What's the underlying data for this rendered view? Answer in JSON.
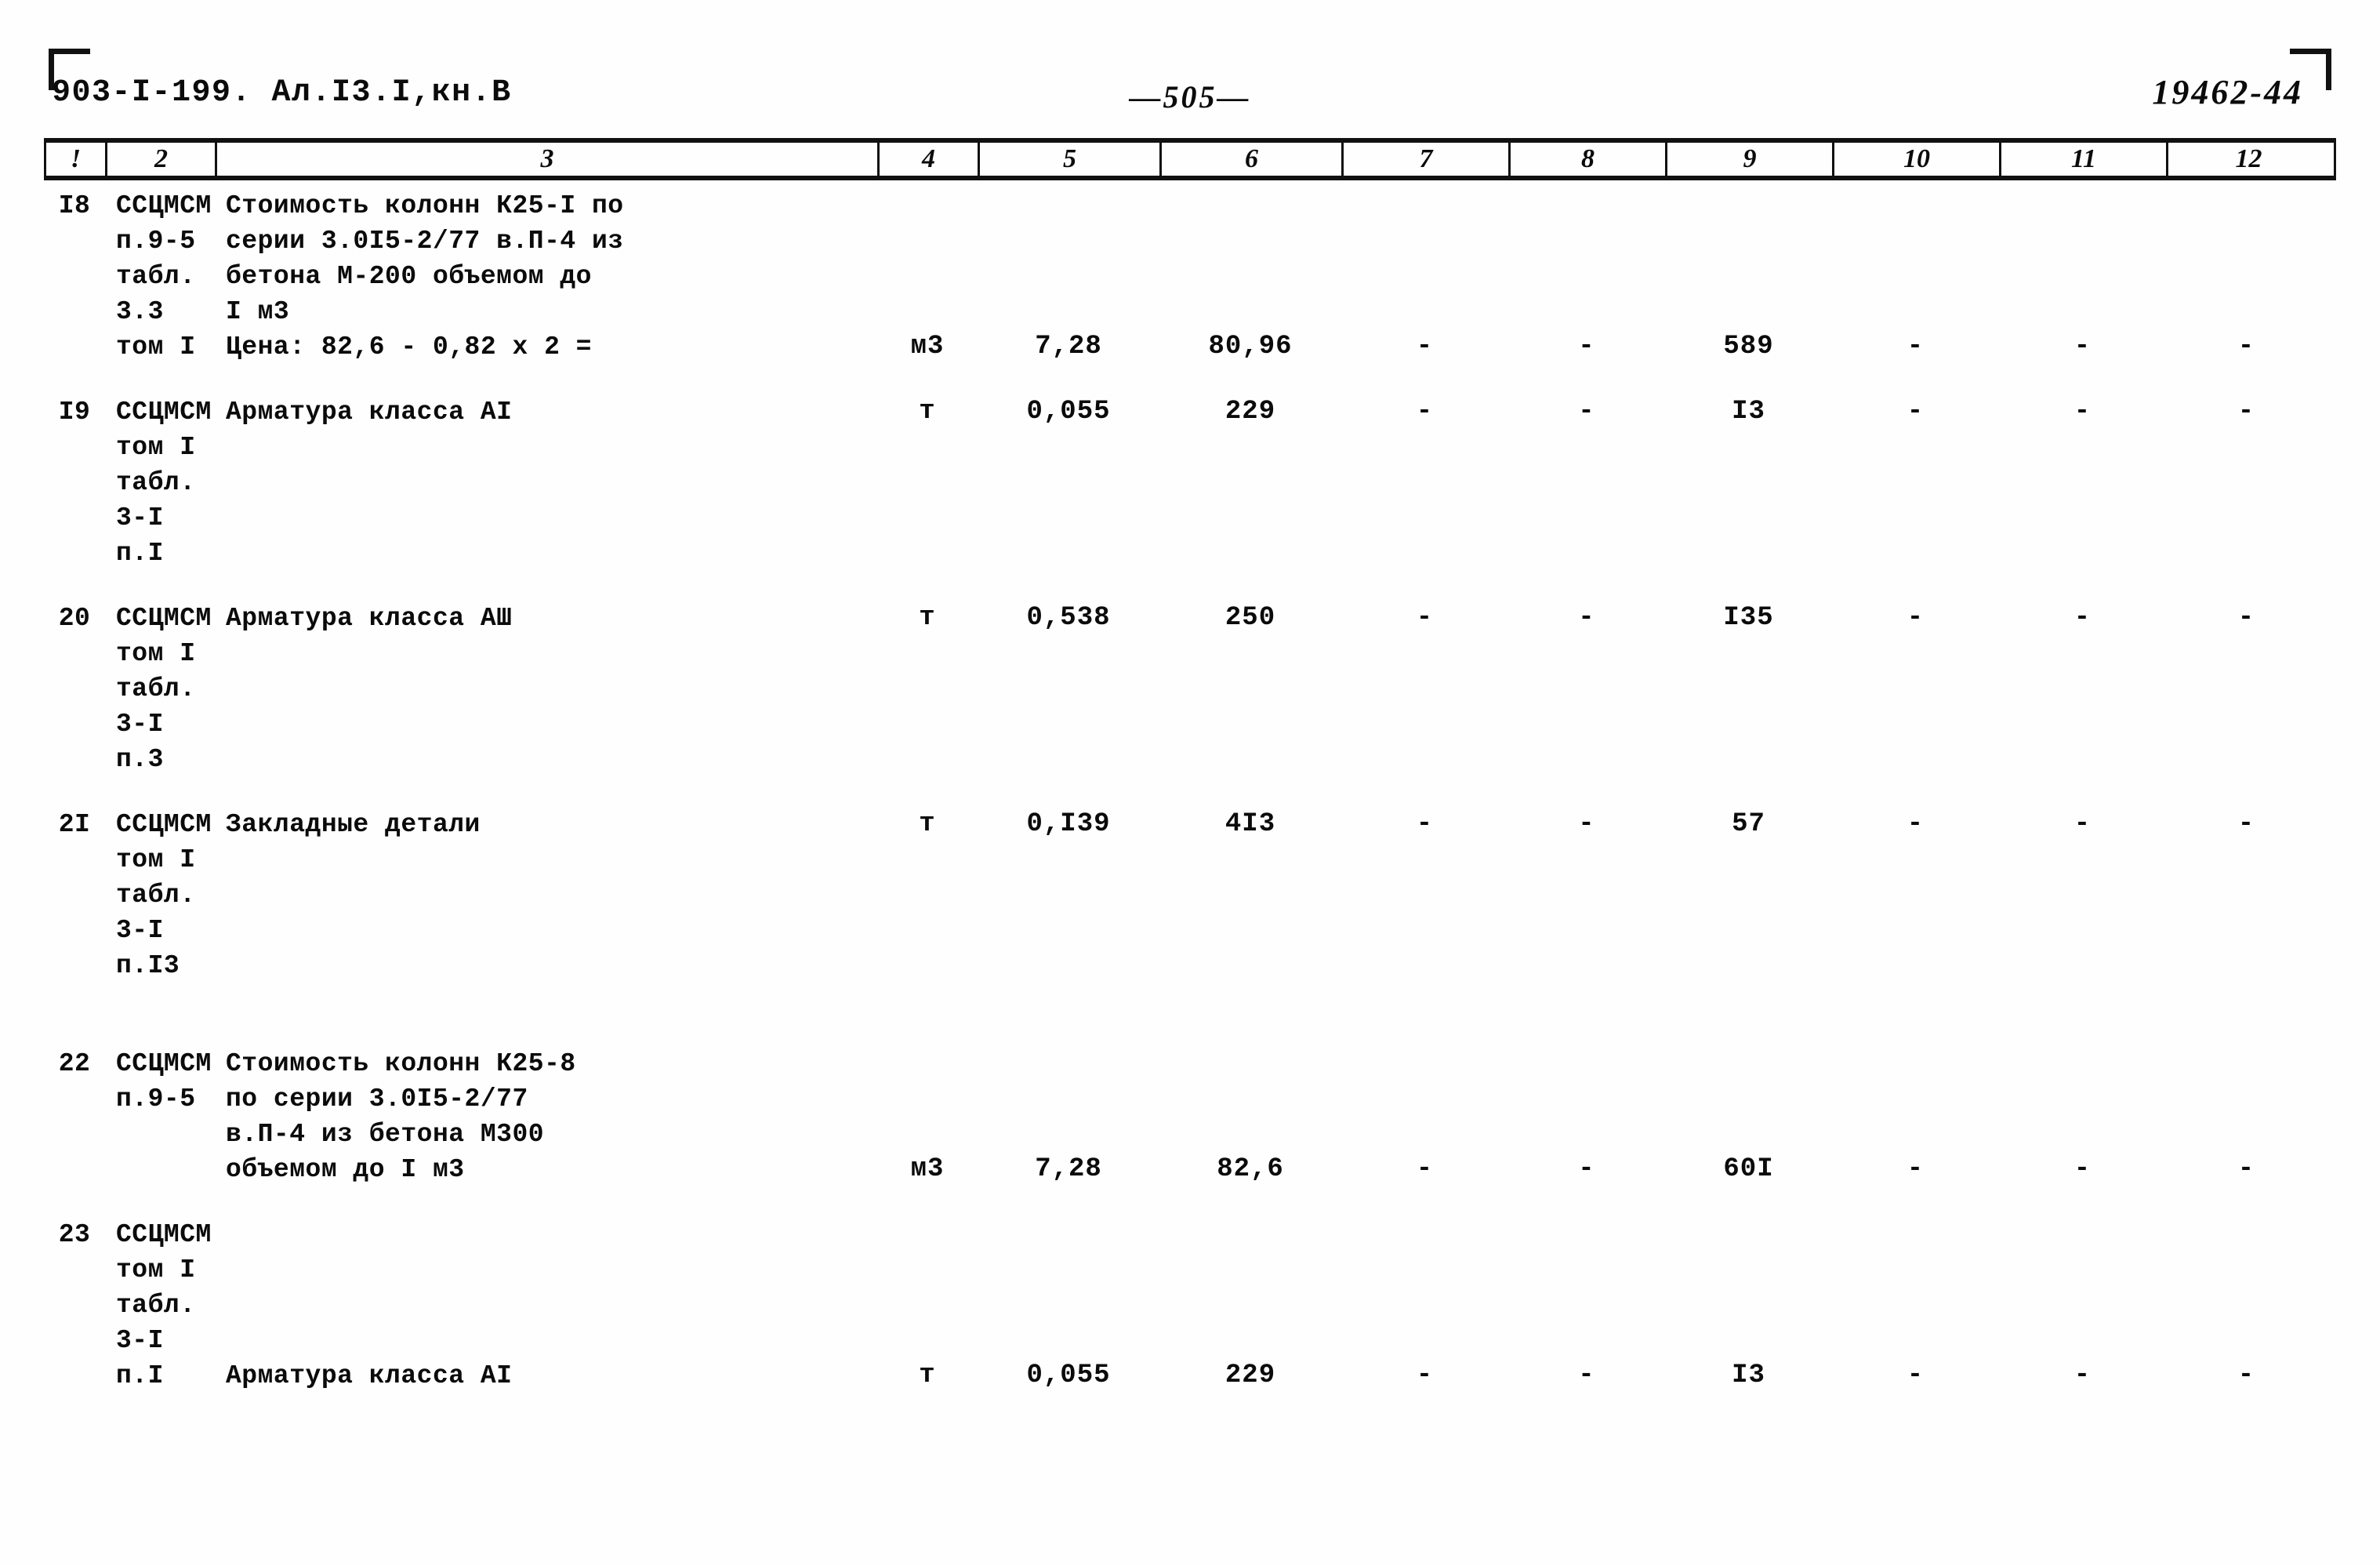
{
  "header": {
    "doc_code": "903-I-199. Ал.I3.I,кн.В",
    "page_number": "—505—",
    "archive_code": "19462-44"
  },
  "table": {
    "column_headers": [
      "!",
      "2",
      "3",
      "4",
      "5",
      "6",
      "7",
      "8",
      "9",
      "10",
      "11",
      "12"
    ],
    "rows": [
      {
        "idx": "I8",
        "ref": "ССЦМСМ\nп.9-5\nтабл.\n3.3\nтом I",
        "desc": "Стоимость колонн К25-I по\nсерии 3.0I5-2/77 в.П-4 из\nбетона М-200 объемом до\nI м3\nЦена: 82,6 - 0,82 x 2 =",
        "unit": "м3",
        "c5": "7,28",
        "c6": "80,96",
        "c7": "-",
        "c8": "-",
        "c9": "589",
        "c10": "-",
        "c11": "-",
        "c12": "-",
        "value_offset_lines": 4
      },
      {
        "idx": "I9",
        "ref": "ССЦМСМ\nтом I\nтабл.\n3-I\nп.I",
        "desc": "Арматура класса АI",
        "unit": "т",
        "c5": "0,055",
        "c6": "229",
        "c7": "-",
        "c8": "-",
        "c9": "I3",
        "c10": "-",
        "c11": "-",
        "c12": "-",
        "value_offset_lines": 0
      },
      {
        "idx": "20",
        "ref": "ССЦМСМ\nтом I\nтабл.\n3-I\nп.3",
        "desc": "Арматура класса АШ",
        "unit": "т",
        "c5": "0,538",
        "c6": "250",
        "c7": "-",
        "c8": "-",
        "c9": "I35",
        "c10": "-",
        "c11": "-",
        "c12": "-",
        "value_offset_lines": 0
      },
      {
        "idx": "2I",
        "ref": "ССЦМСМ\nтом I\nтабл.\n3-I\nп.I3",
        "desc": "Закладные детали",
        "unit": "т",
        "c5": "0,I39",
        "c6": "4I3",
        "c7": "-",
        "c8": "-",
        "c9": "57",
        "c10": "-",
        "c11": "-",
        "c12": "-",
        "value_offset_lines": 0
      },
      {
        "idx": "22",
        "ref": "ССЦМСМ\nп.9-5",
        "desc": "Стоимость колонн К25-8\nпо серии 3.0I5-2/77\n  в.П-4 из бетона М300\nобъемом до I м3",
        "unit": "м3",
        "c5": "7,28",
        "c6": "82,6",
        "c7": "-",
        "c8": "-",
        "c9": "60I",
        "c10": "-",
        "c11": "-",
        "c12": "-",
        "value_offset_lines": 3
      },
      {
        "idx": "23",
        "ref": "ССЦМСМ\nтом I\nтабл.\n3-I\nп.I",
        "desc": "\n\n\n\n  Арматура класса АI",
        "unit": "т",
        "c5": "0,055",
        "c6": "229",
        "c7": "-",
        "c8": "-",
        "c9": "I3",
        "c10": "-",
        "c11": "-",
        "c12": "-",
        "value_offset_lines": 4
      }
    ]
  }
}
